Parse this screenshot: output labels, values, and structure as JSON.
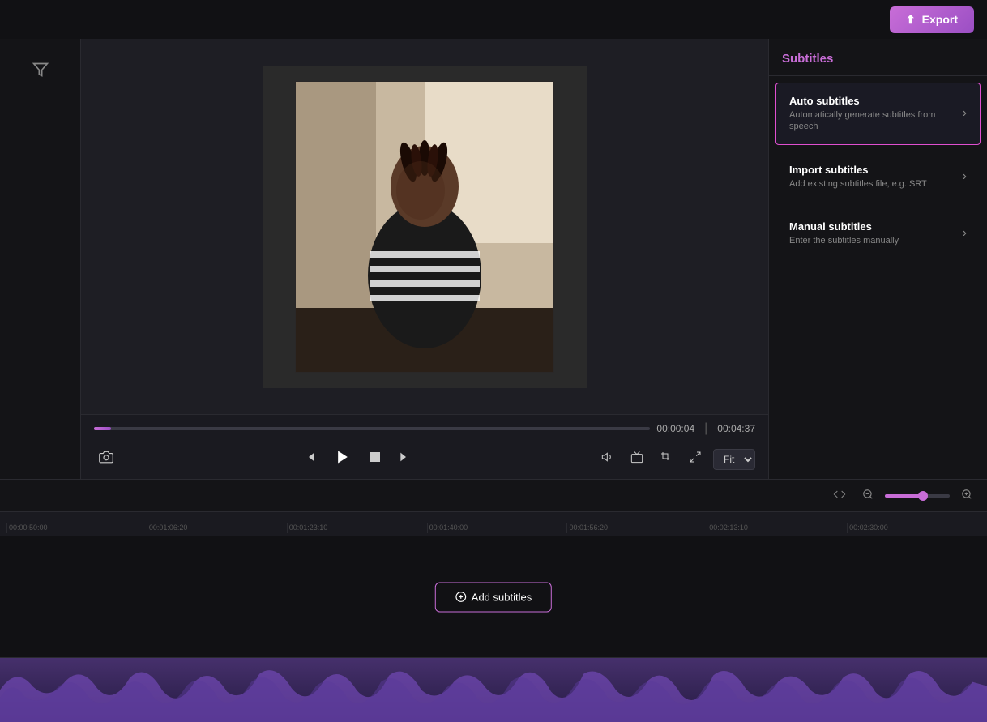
{
  "topbar": {
    "export_label": "Export"
  },
  "preview": {
    "current_time": "00:00:04",
    "total_time": "00:04:37",
    "fit_label": "Fit"
  },
  "subtitles_panel": {
    "title": "Subtitles",
    "options": [
      {
        "id": "auto",
        "title": "Auto subtitles",
        "description": "Automatically generate subtitles from speech",
        "active": true
      },
      {
        "id": "import",
        "title": "Import subtitles",
        "description": "Add existing subtitles file, e.g. SRT",
        "active": false
      },
      {
        "id": "manual",
        "title": "Manual subtitles",
        "description": "Enter the subtitles manually",
        "active": false
      }
    ]
  },
  "timeline": {
    "ruler_marks": [
      "00:00:50:00",
      "00:01:06:20",
      "00:01:23:10",
      "00:01:40:00",
      "00:01:56:20",
      "00:02:13:10",
      "00:02:30:00"
    ],
    "add_subtitles_label": "Add subtitles"
  }
}
